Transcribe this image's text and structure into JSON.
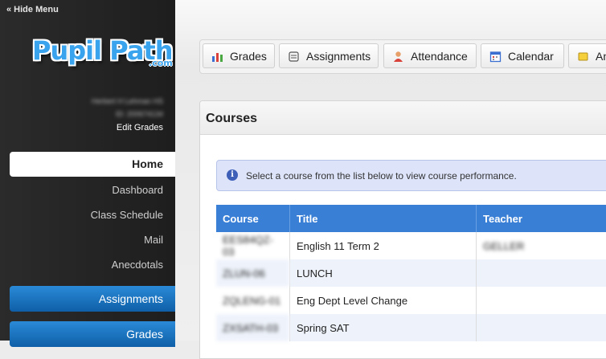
{
  "sidebar": {
    "hide_menu": "« Hide Menu",
    "logo_text": "Pupil Path",
    "logo_suffix": ".com",
    "student_name": "Herbert H Lehman HS",
    "student_id": "ID: 200674134",
    "edit_grades": "Edit Grades",
    "home": "Home",
    "sub_items": [
      "Dashboard",
      "Class Schedule",
      "Mail",
      "Anecdotals"
    ],
    "sections": [
      "Assignments",
      "Grades"
    ]
  },
  "toolbar": {
    "buttons": [
      {
        "label": "Grades",
        "icon": "bar-chart-icon"
      },
      {
        "label": "Assignments",
        "icon": "notebook-icon"
      },
      {
        "label": "Attendance",
        "icon": "person-icon"
      },
      {
        "label": "Calendar",
        "icon": "calendar-icon"
      },
      {
        "label": "Anecdotals",
        "icon": "note-icon"
      }
    ]
  },
  "panel": {
    "title": "Courses",
    "info": "Select a course from the list below to view course performance."
  },
  "table": {
    "headers": [
      "Course",
      "Title",
      "Teacher"
    ],
    "rows": [
      {
        "course": "EES84QZ-03",
        "title": "English 11 Term 2",
        "teacher": "GELLER"
      },
      {
        "course": "ZLUN-06",
        "title": "LUNCH",
        "teacher": ""
      },
      {
        "course": "ZQLENG-01",
        "title": "Eng Dept Level Change",
        "teacher": ""
      },
      {
        "course": "ZXSATH-03",
        "title": "Spring SAT",
        "teacher": ""
      }
    ]
  },
  "colors": {
    "accent": "#3a7fd6",
    "section_button": "#1a73c2",
    "info_bg": "#dde4fa"
  }
}
